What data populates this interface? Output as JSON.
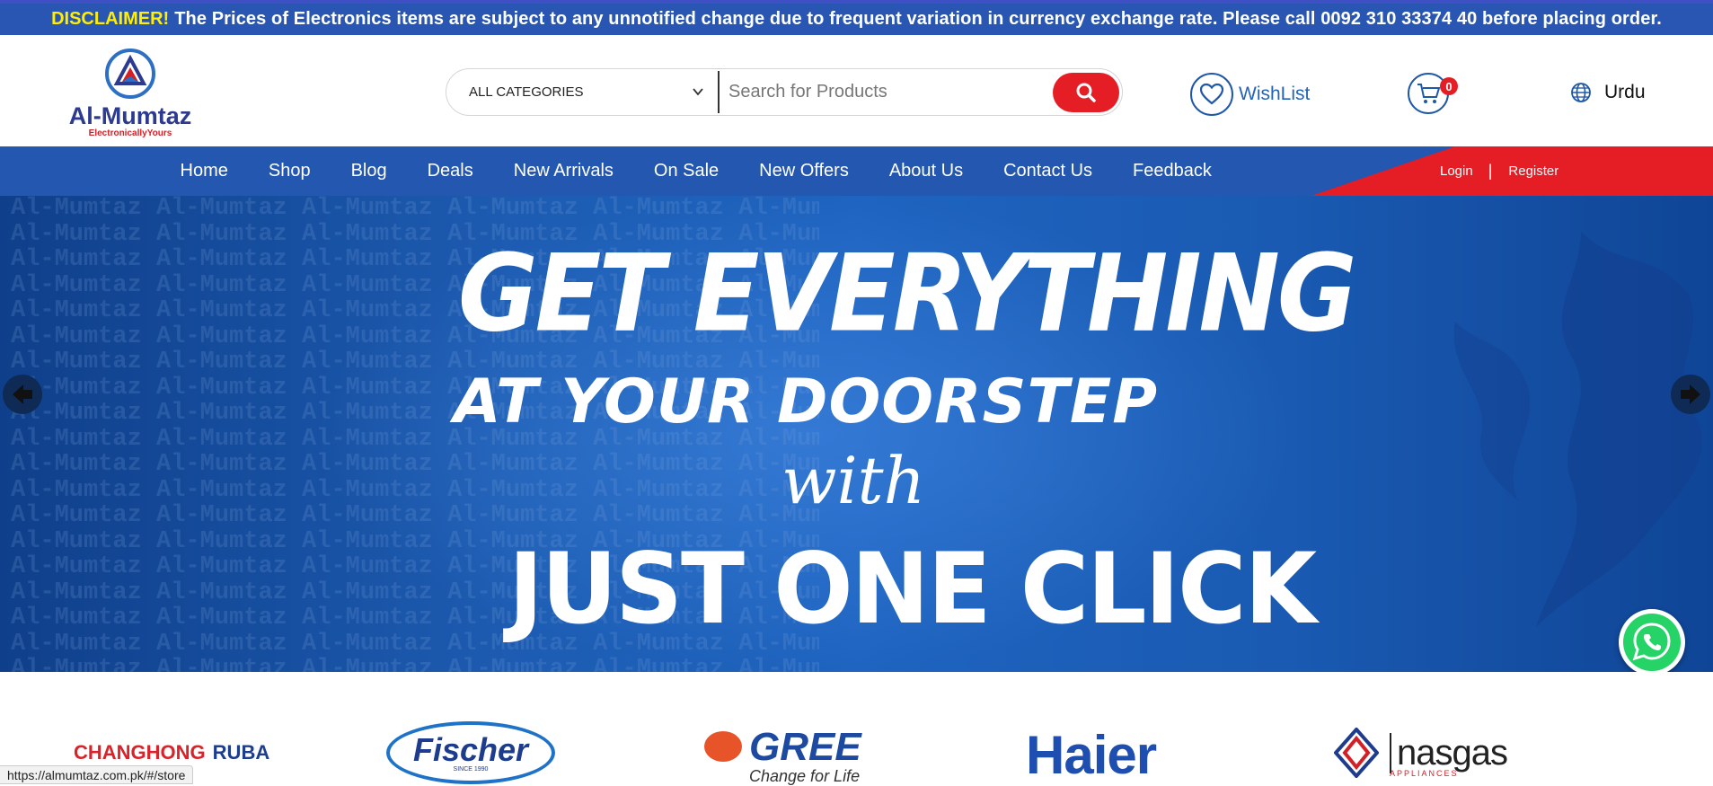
{
  "disclaimer": {
    "label": "DISCLAIMER!",
    "text": "The Prices of Electronics items are subject to any unnotified change due to frequent variation in currency exchange rate. Please call 0092 310 33374 40 before placing order."
  },
  "logo": {
    "name": "Al-Mumtaz",
    "tagline": "ElectronicallyYours"
  },
  "search": {
    "category": "ALL CATEGORIES",
    "placeholder": "Search for Products"
  },
  "wishlist": {
    "label": "WishList"
  },
  "cart": {
    "count": "0"
  },
  "language": {
    "label": "Urdu"
  },
  "nav": {
    "items": [
      {
        "label": "Home"
      },
      {
        "label": "Shop"
      },
      {
        "label": "Blog"
      },
      {
        "label": "Deals"
      },
      {
        "label": "New Arrivals"
      },
      {
        "label": "On Sale"
      },
      {
        "label": "New Offers"
      },
      {
        "label": "About Us"
      },
      {
        "label": "Contact Us"
      },
      {
        "label": "Feedback"
      }
    ],
    "login": "Login",
    "separator": "|",
    "register": "Register"
  },
  "banner": {
    "watermark": "Al-Mumtaz Al-Mumtaz Al-Mumtaz Al-Mumtaz Al-Mumtaz Al-Mumtaz",
    "line1": "GET EVERYTHING",
    "line2": "AT YOUR DOORSTEP",
    "line3": "with",
    "line4": "JUST ONE CLICK"
  },
  "brands": {
    "changhong": "CHANGHONG",
    "ruba": "RUBA",
    "fischer": "Fischer",
    "fischer_since": "SINCE 1990",
    "gree": "GREE",
    "gree_slogan": "Change for Life",
    "haier": "Haier",
    "nasgas": "nasgas",
    "nasgas_sub": "APPLIANCES"
  },
  "status_bar": {
    "url": "https://almumtaz.com.pk/#/store"
  },
  "colors": {
    "primary_blue": "#2357b0",
    "accent_red": "#e51e25",
    "disclaimer_yellow": "#ffee00"
  },
  "icons": [
    "search-icon",
    "heart-icon",
    "cart-icon",
    "globe-icon",
    "chevron-down-icon",
    "arrow-left-icon",
    "arrow-right-icon",
    "whatsapp-icon"
  ]
}
